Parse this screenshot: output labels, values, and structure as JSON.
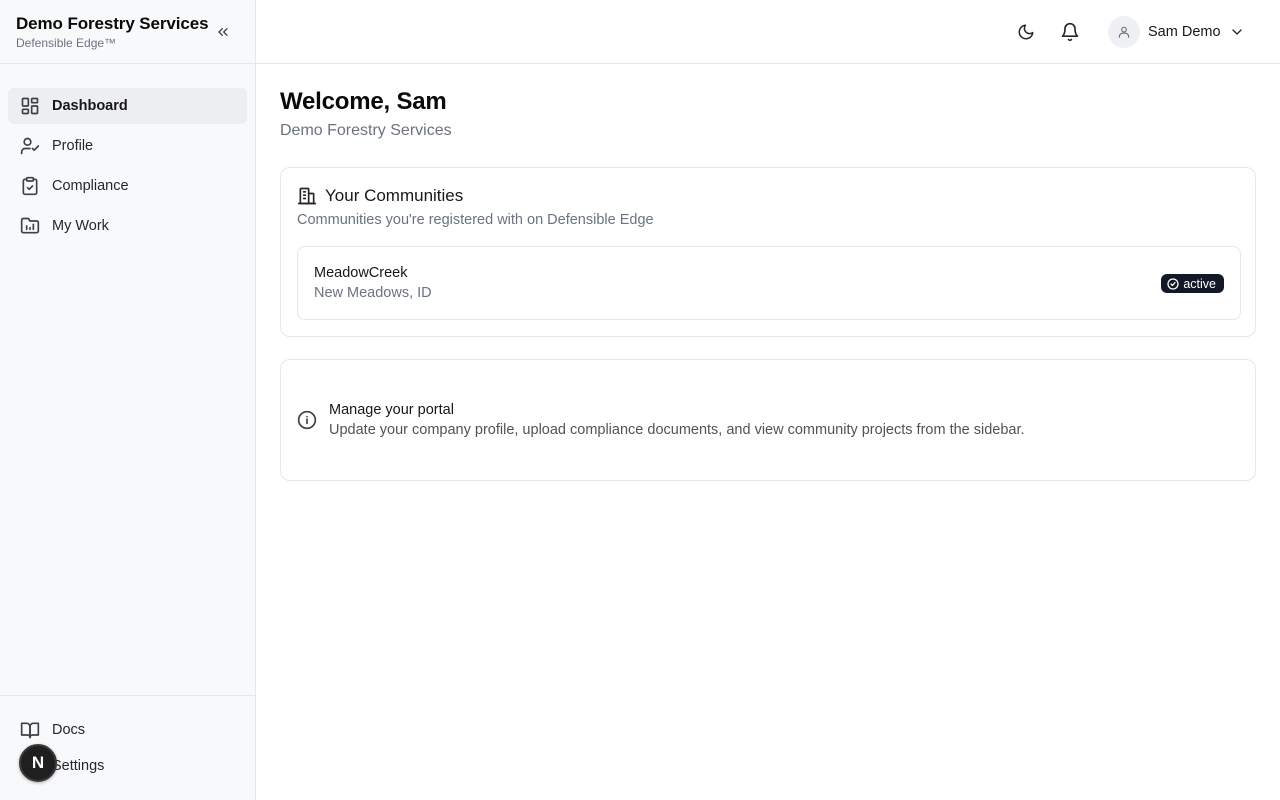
{
  "sidebar": {
    "brand_title": "Demo Forestry Services",
    "brand_subtitle": "Defensible Edge™",
    "items": [
      {
        "label": "Dashboard",
        "icon": "dashboard-icon",
        "active": true
      },
      {
        "label": "Profile",
        "icon": "user-check-icon"
      },
      {
        "label": "Compliance",
        "icon": "clipboard-check-icon"
      },
      {
        "label": "My Work",
        "icon": "chart-folder-icon"
      }
    ],
    "footer_items": [
      {
        "label": "Docs",
        "icon": "book-icon"
      },
      {
        "label": "Settings",
        "icon": "gear-icon"
      }
    ],
    "fab_label": "N"
  },
  "header": {
    "user_name": "Sam Demo"
  },
  "main": {
    "welcome": "Welcome, Sam",
    "company": "Demo Forestry Services",
    "communities": {
      "title": "Your Communities",
      "description": "Communities you're registered with on Defensible Edge",
      "items": [
        {
          "name": "MeadowCreek",
          "location": "New Meadows, ID",
          "status": "active"
        }
      ]
    },
    "info": {
      "title": "Manage your portal",
      "text": "Update your company profile, upload compliance documents, and view community projects from the sidebar."
    }
  },
  "colors": {
    "sidebar_bg": "#f8f9fb",
    "active_item_bg": "#eceef2",
    "badge_bg": "#111827",
    "border": "#e5e7eb"
  }
}
